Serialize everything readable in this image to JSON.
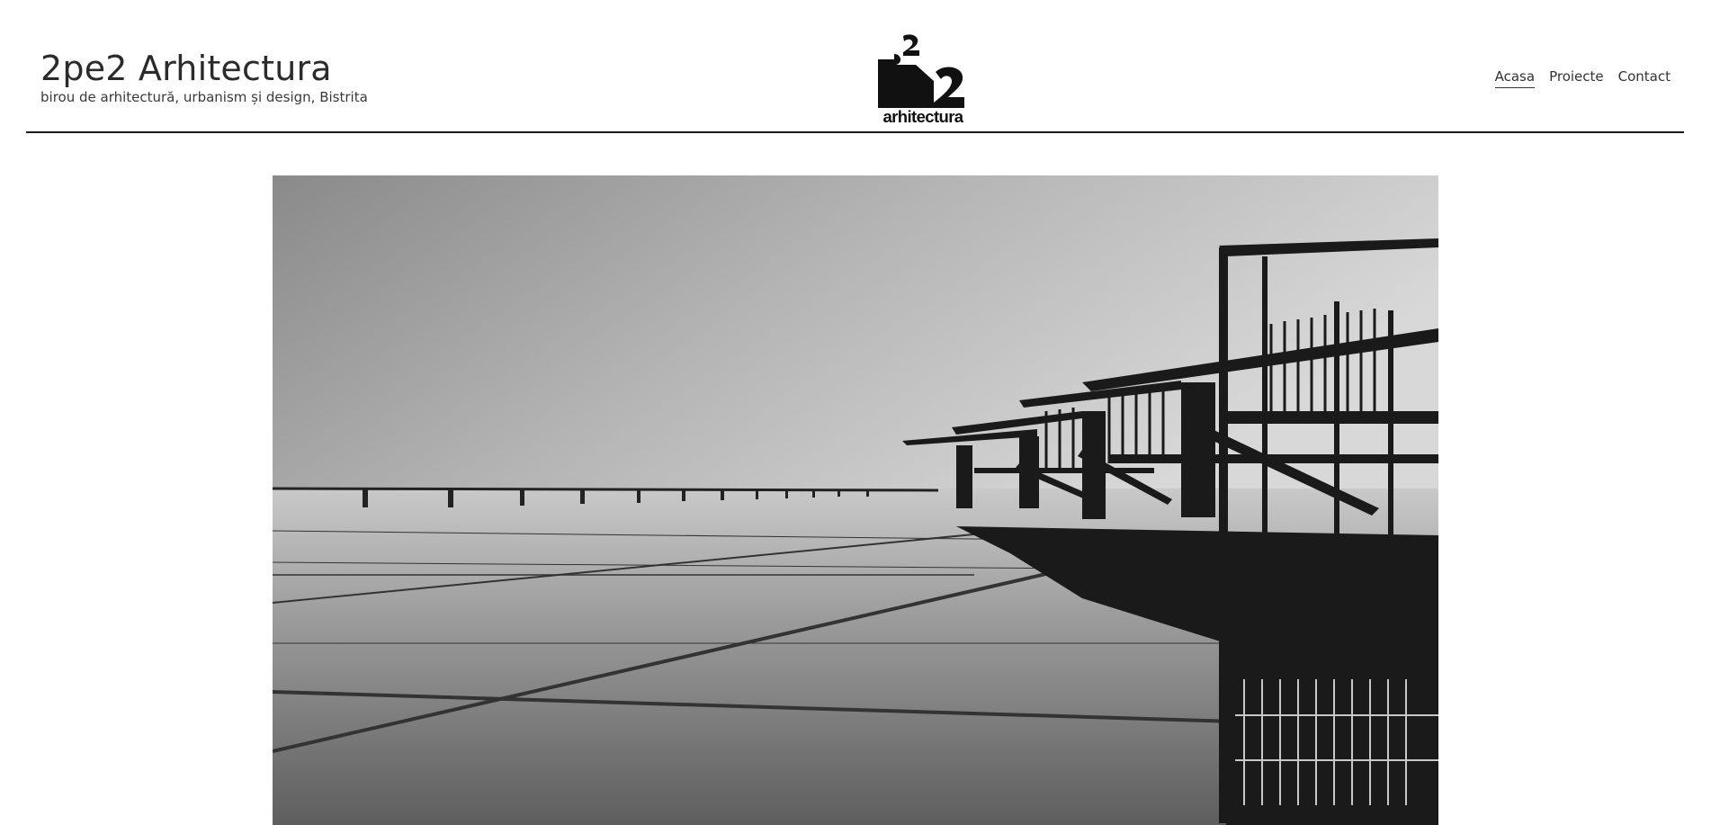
{
  "site": {
    "title": "2pe2 Arhitectura",
    "tagline": "birou de arhitectură, urbanism și design, Bistrita"
  },
  "logo": {
    "word": "arhitectura",
    "icon": "2pe2-logo-icon"
  },
  "nav": {
    "items": [
      {
        "label": "Acasa",
        "active": true
      },
      {
        "label": "Proiecte",
        "active": false
      },
      {
        "label": "Contact",
        "active": false
      }
    ]
  },
  "colors": {
    "text": "#333333",
    "divider": "#1a1a1a",
    "background": "#ffffff"
  }
}
